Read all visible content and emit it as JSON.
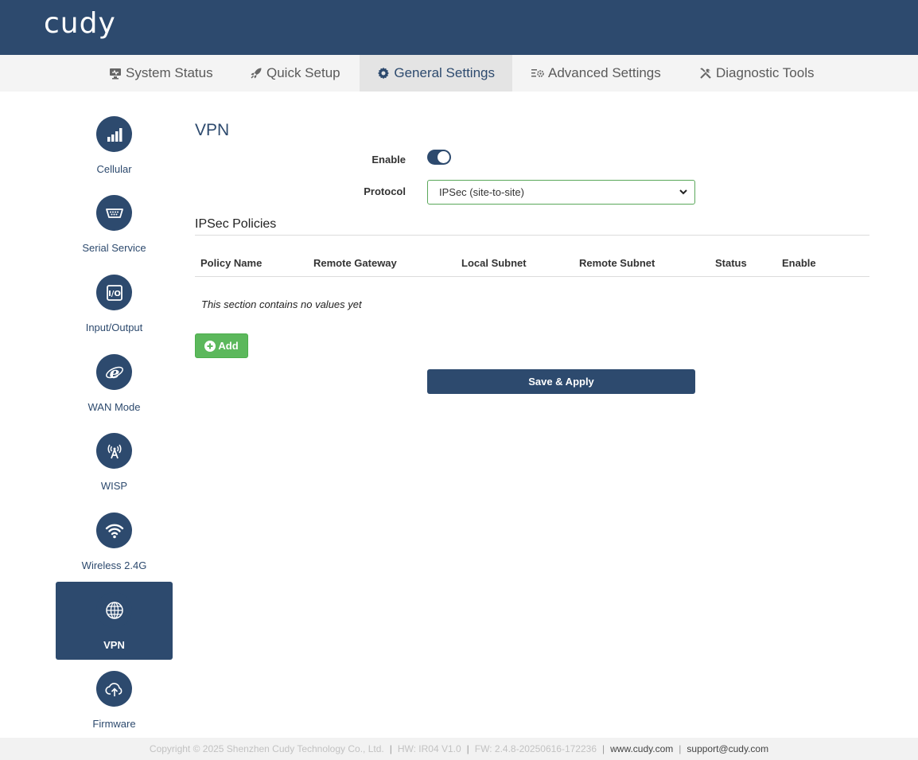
{
  "header": {
    "logo": "cudy"
  },
  "topnav": {
    "tabs": [
      {
        "label": "System Status",
        "icon": "monitor-icon"
      },
      {
        "label": "Quick Setup",
        "icon": "rocket-icon"
      },
      {
        "label": "General Settings",
        "icon": "gear-icon",
        "active": true
      },
      {
        "label": "Advanced Settings",
        "icon": "list-gear-icon"
      },
      {
        "label": "Diagnostic Tools",
        "icon": "tools-icon"
      }
    ]
  },
  "sidebar": {
    "items": [
      {
        "label": "Cellular",
        "icon": "signal-bars-icon"
      },
      {
        "label": "Serial Service",
        "icon": "serial-port-icon"
      },
      {
        "label": "Input/Output",
        "icon": "io-icon"
      },
      {
        "label": "WAN Mode",
        "icon": "internet-e-icon"
      },
      {
        "label": "WISP",
        "icon": "antenna-icon"
      },
      {
        "label": "Wireless 2.4G",
        "icon": "wifi-icon"
      },
      {
        "label": "VPN",
        "icon": "globe-icon",
        "active": true
      },
      {
        "label": "Firmware",
        "icon": "cloud-upload-icon"
      }
    ]
  },
  "main": {
    "title": "VPN",
    "enable_label": "Enable",
    "enable_value": true,
    "protocol_label": "Protocol",
    "protocol_value": "IPSec (site-to-site)",
    "policies_title": "IPSec Policies",
    "columns": [
      "Policy Name",
      "Remote Gateway",
      "Local Subnet",
      "Remote Subnet",
      "Status",
      "Enable"
    ],
    "empty_text": "This section contains no values yet",
    "add_label": "Add",
    "save_label": "Save & Apply"
  },
  "footer": {
    "copyright": "Copyright © 2025 Shenzhen Cudy Technology Co., Ltd.",
    "hw": "HW: IR04 V1.0",
    "fw": "FW: 2.4.8-20250616-172236",
    "website": "www.cudy.com",
    "email": "support@cudy.com"
  },
  "colors": {
    "brand": "#2d4a6e",
    "add": "#5cb85c",
    "select_border": "#5aa85a"
  }
}
